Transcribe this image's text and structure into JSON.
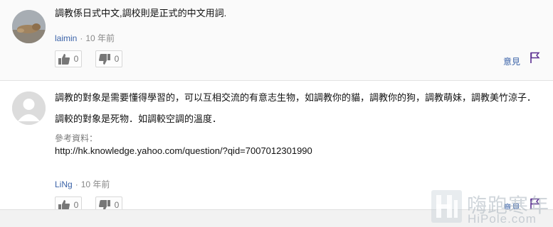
{
  "answers": [
    {
      "paragraphs": [
        "調教係日式中文,調校則是正式的中文用詞."
      ],
      "author": "laimin",
      "separator": "·",
      "time": "10 年前",
      "upvotes": "0",
      "downvotes": "0",
      "feedback_label": "意見"
    },
    {
      "paragraphs": [
        "調教的對象是需要懂得學習的，可以互相交流的有意志生物，如調教你的貓，調教你的狗，調教萌妹，調教美竹涼子．",
        "調較的對象是死物．如調較空調的溫度．"
      ],
      "source_label": "參考資料：",
      "source_url": "http://hk.knowledge.yahoo.com/question/?qid=7007012301990",
      "author": "LiNg",
      "separator": "·",
      "time": "10 年前",
      "upvotes": "0",
      "downvotes": "0",
      "feedback_label": "意見"
    }
  ],
  "watermark": {
    "title": "嗨跑寒年",
    "domain": "HiPole.com"
  },
  "colors": {
    "link": "#3b63a8",
    "flag": "#5b2e91",
    "muted": "#888888"
  },
  "icons": [
    "user-avatar-icon",
    "thumbs-up-icon",
    "thumbs-down-icon",
    "flag-icon"
  ]
}
